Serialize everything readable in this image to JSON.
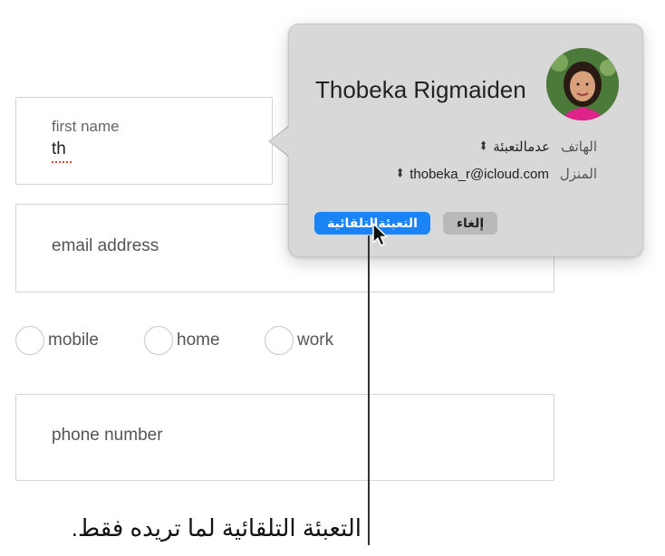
{
  "form": {
    "first_name": {
      "label": "first name",
      "value": "th"
    },
    "email": {
      "label": "email address"
    },
    "radios": [
      {
        "label": "mobile"
      },
      {
        "label": "home"
      },
      {
        "label": "work"
      }
    ],
    "phone": {
      "label": "phone number"
    }
  },
  "popover": {
    "name": "Thobeka Rigmaiden",
    "rows": [
      {
        "key": "الهاتف",
        "value": "عدمالتعبئة"
      },
      {
        "key": "المنزل",
        "value": "thobeka_r@icloud.com"
      }
    ],
    "autofill_button": "التعبئةالتلقائية",
    "cancel_button": "إلغاء"
  },
  "callout": "التعبئة التلقائية لما تريده فقط.",
  "colors": {
    "accent": "#1a83f5",
    "popover_bg": "#d8d8d8",
    "spell_error": "#e0453a"
  }
}
